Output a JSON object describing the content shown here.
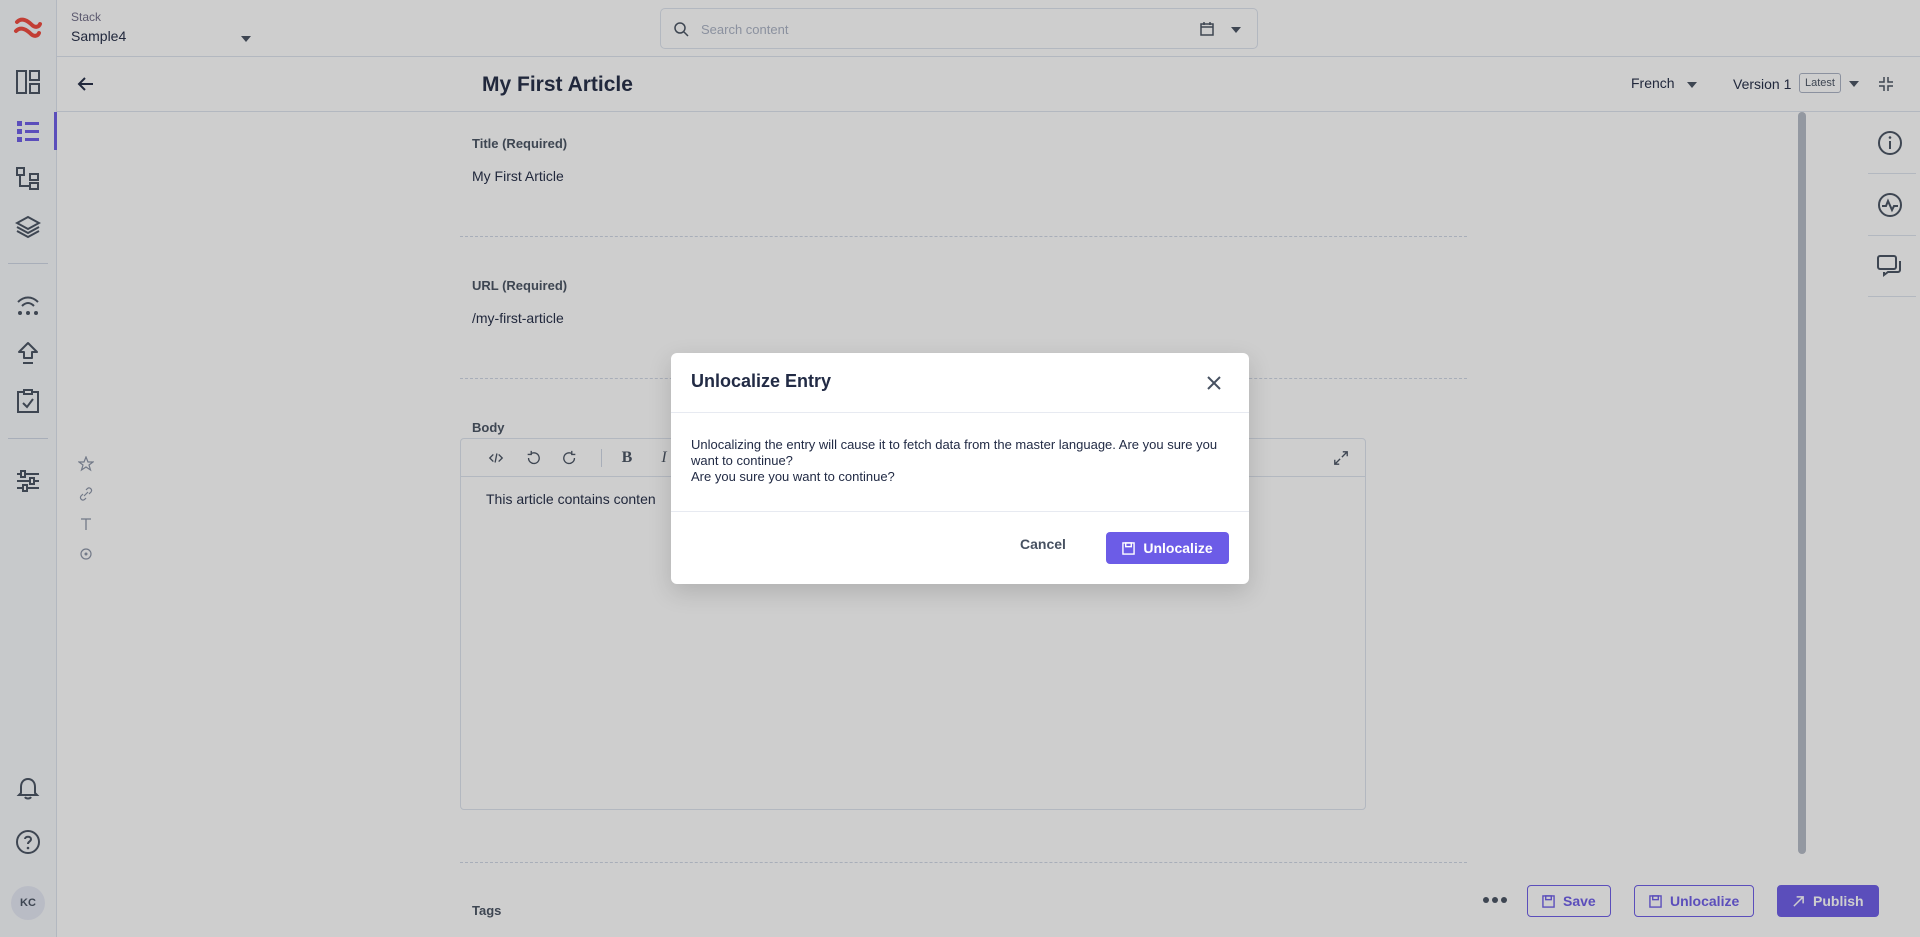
{
  "app": {
    "colors": {
      "accent": "#6c5ce7",
      "text": "#222b45",
      "muted": "#475161",
      "border": "#dde3ee",
      "logo": "#f0473b"
    }
  },
  "rail": {
    "items": [
      {
        "name": "dashboard-icon"
      },
      {
        "name": "entries-icon",
        "active": true
      },
      {
        "name": "content-models-icon"
      },
      {
        "name": "assets-icon"
      },
      {
        "name": "workflows-icon"
      },
      {
        "name": "deploy-icon"
      },
      {
        "name": "releases-icon"
      },
      {
        "name": "settings-icon"
      },
      {
        "name": "notifications-icon"
      },
      {
        "name": "help-icon"
      }
    ],
    "avatar_initials": "KC"
  },
  "topbar": {
    "stack_label": "Stack",
    "stack_value": "Sample4",
    "search_placeholder": "Search content"
  },
  "entry": {
    "title": "My First Article",
    "language": "French",
    "version": "Version 1",
    "version_badge": "Latest"
  },
  "fields": {
    "title_label": "Title (Required)",
    "title_value": "My First Article",
    "url_label": "URL (Required)",
    "url_value": "/my-first-article",
    "body_label": "Body",
    "body_content": "This article contains conten",
    "tags_label": "Tags"
  },
  "editor_toolbar": {
    "buttons": [
      "source-code-icon",
      "undo-icon",
      "redo-icon",
      "bold-icon",
      "italic-icon",
      "fullscreen-icon"
    ]
  },
  "actions": {
    "save": "Save",
    "unlocalize": "Unlocalize",
    "publish": "Publish"
  },
  "modal": {
    "title": "Unlocalize Entry",
    "message": "Unlocalizing the entry will cause it to fetch data from the master language. Are you sure you want to continue?",
    "message_2": "Are you sure you want to continue?",
    "cancel": "Cancel",
    "confirm": "Unlocalize"
  }
}
